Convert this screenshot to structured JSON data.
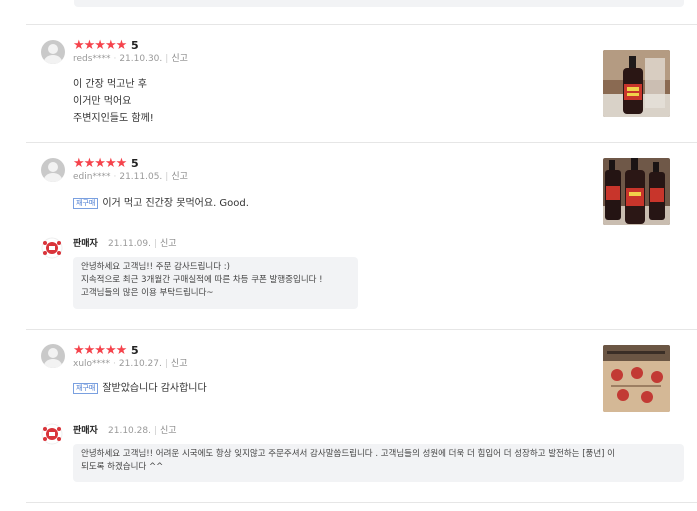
{
  "reviews": [
    {
      "rating_stars": "★★★★★",
      "score": "5",
      "user": "reds****",
      "date": "21.10.30.",
      "report": "신고",
      "lines": [
        "이 간장 먹고난 후",
        "이거만 먹어요",
        "주변지인들도 함께!"
      ],
      "thumb_icon": "soy-sauce-bottle-photo"
    },
    {
      "rating_stars": "★★★★★",
      "score": "5",
      "user": "edin****",
      "date": "21.11.05.",
      "report": "신고",
      "badge": "재구매",
      "text": "이거 먹고 진간장 못먹어요. Good.",
      "thumb_icon": "soy-sauce-bottles-photo",
      "seller_reply": {
        "name": "판매자",
        "date": "21.11.09.",
        "report": "신고",
        "lines": [
          "안녕하세요 고객님!! 주문 감사드립니다 :)",
          "지속적으로 최근 3개월간 구매실적에 따른 차등 쿠폰 발행중입니다 !",
          "고객님들의 많은 이용 부탁드립니다~"
        ]
      }
    },
    {
      "rating_stars": "★★★★★",
      "score": "5",
      "user": "xulo****",
      "date": "21.10.27.",
      "report": "신고",
      "badge": "재구매",
      "text": "잘받았습니다 감사합니다",
      "thumb_icon": "package-box-photo",
      "seller_reply": {
        "name": "판매자",
        "date": "21.10.28.",
        "report": "신고",
        "lines": [
          "안녕하세요 고객님!! 어려운 시국에도 항상 잊지않고 주문주셔서 감사말씀드립니다 . 고객님들의 성원에 더욱 더 힘입어 더 성장하고 발전하는 [풍년] 이",
          "되도록 하겠습니다 ^^"
        ]
      }
    }
  ],
  "colors": {
    "star": "#f5434c",
    "badge": "#4a7bd1",
    "reply_bg": "#f2f3f5"
  }
}
